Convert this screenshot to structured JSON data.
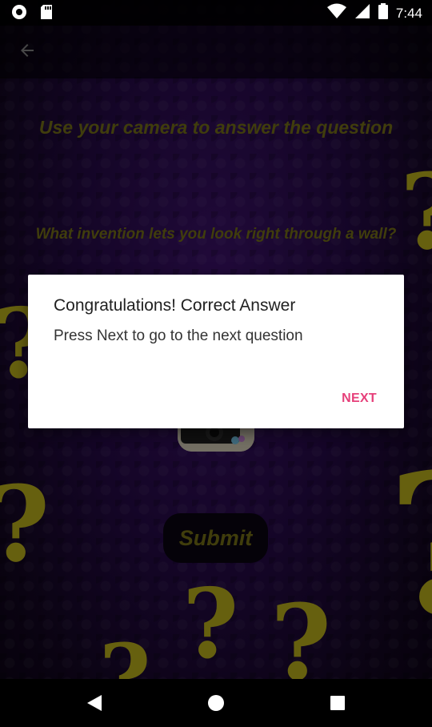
{
  "status_bar": {
    "time": "7:44",
    "icons": [
      "record-icon",
      "sd-card-icon",
      "wifi-icon",
      "signal-icon",
      "battery-icon"
    ]
  },
  "app_bar": {
    "back_icon": "arrow-left-icon"
  },
  "main": {
    "heading": "Use your camera to answer the question",
    "question": "What invention lets you look right through a wall?",
    "submit_label": "Submit"
  },
  "dialog": {
    "title": "Congratulations! Correct Answer",
    "message": "Press Next to go to the next question",
    "next_label": "NEXT"
  },
  "nav_bar": {
    "icons": [
      "back-triangle-icon",
      "home-circle-icon",
      "recents-square-icon"
    ]
  },
  "colors": {
    "accent_text": "#6f6a16",
    "question_mark": "#b0a51a",
    "dialog_button": "#e6407a",
    "background": "#240a44"
  }
}
